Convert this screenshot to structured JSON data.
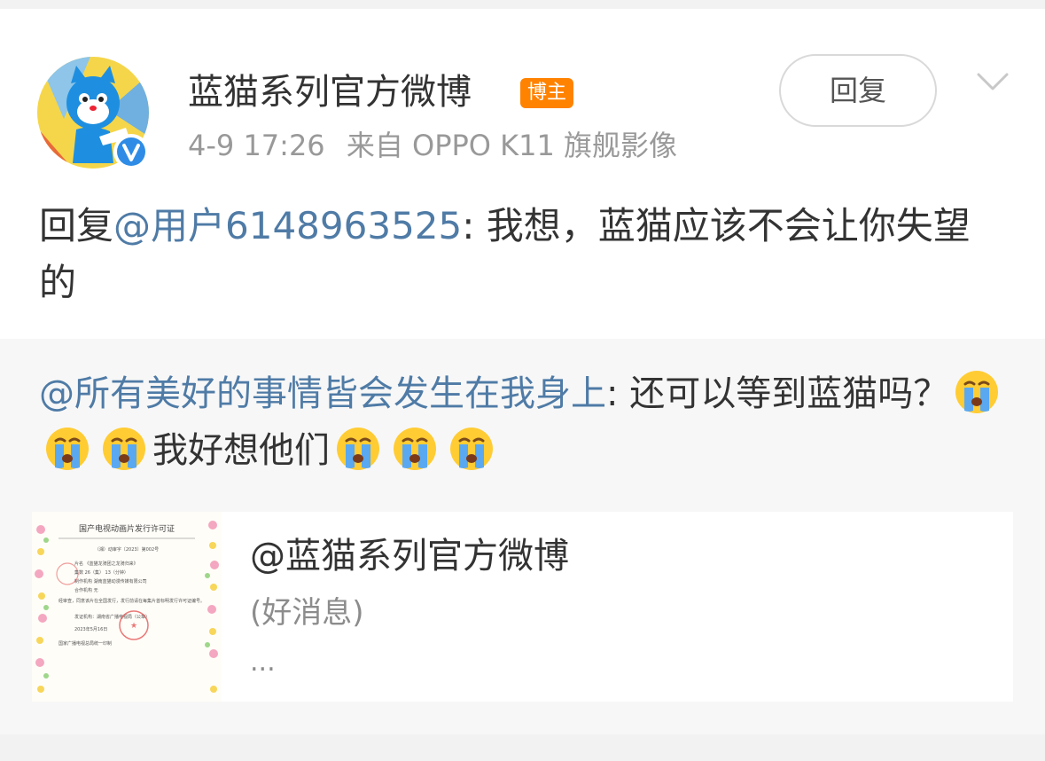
{
  "post": {
    "author": "蓝猫系列官方微博",
    "author_badge": "博主",
    "time": "4-9 17:26",
    "source": "来自 OPPO K11 旗舰影像",
    "reply_button": "回复",
    "text_prefix": "回复",
    "mention": "@用户6148963525",
    "text_body": ": 我想，蓝猫应该不会让你失望的",
    "avatar_icon": "blue-cat-avatar",
    "verified_icon": "verified-v-icon",
    "more_icon": "chevron-down-icon"
  },
  "quote": {
    "mention": "@所有美好的事情皆会发生在我身上",
    "text_a": ": 还可以等到蓝猫吗？",
    "text_b": "我好想他们",
    "emoji_name": "crying-face-emoji",
    "card": {
      "title": "@蓝猫系列官方微博",
      "subtitle": "(好消息)",
      "ellipsis": "...",
      "thumb_title": "国产电视动画片发行许可证",
      "thumb_number": "（湘）动审字〔2023〕第002号",
      "thumb_lines": [
        "片名 《蓝猫龙骑团之龙骑归来》",
        "集数 26（集） 13（分钟）",
        "制作机构 湖南蓝猫动漫传媒有限公司",
        "合作机构 无",
        "经审查，同意该片在全国发行，发行前请在每集片首标明发行许可证编号。",
        "发证机构：湖南省广播电视局（公章）",
        "2023年5月16日",
        "国家广播电视总局统一印制"
      ]
    }
  },
  "colors": {
    "mention": "#4f7ba6",
    "badge": "#ff8200",
    "verified": "#2e8ce6"
  }
}
